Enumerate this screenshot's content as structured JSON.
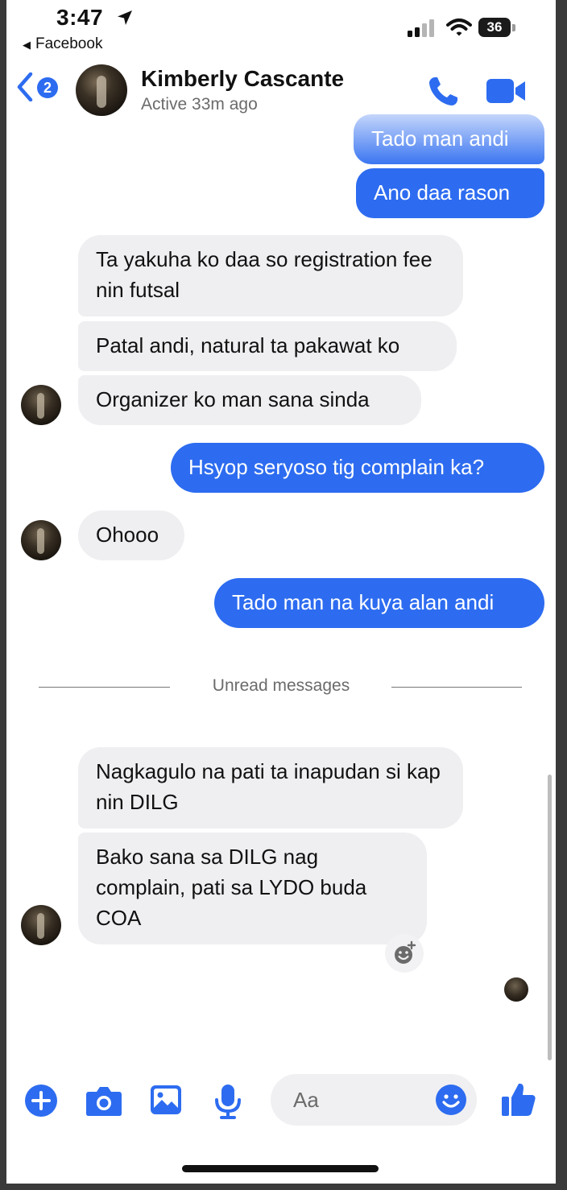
{
  "status_bar": {
    "time": "3:47",
    "back_app": "Facebook",
    "battery": "36"
  },
  "header": {
    "back_badge": "2",
    "contact_name": "Kimberly Cascante",
    "contact_status": "Active 33m ago"
  },
  "messages": [
    {
      "from": "me",
      "text": "Tado man andi"
    },
    {
      "from": "me",
      "text": "Ano daa rason"
    },
    {
      "from": "them",
      "text": "Ta yakuha ko daa so registration fee nin futsal"
    },
    {
      "from": "them",
      "text": "Patal andi, natural ta pakawat ko"
    },
    {
      "from": "them",
      "text": "Organizer ko man sana sinda"
    },
    {
      "from": "me",
      "text": "Hsyop seryoso tig complain ka?"
    },
    {
      "from": "them",
      "text": "Ohooo"
    },
    {
      "from": "me",
      "text": "Tado man na kuya alan andi"
    },
    {
      "from": "them",
      "text": "Nagkagulo na pati ta inapudan si kap nin DILG"
    },
    {
      "from": "them",
      "text": "Bako sana sa DILG nag complain, pati sa LYDO buda COA"
    }
  ],
  "unread_divider": "Unread messages",
  "composer": {
    "placeholder": "Aa"
  },
  "colors": {
    "accent": "#2d6cf0",
    "incoming_bubble": "#efeff2"
  },
  "icons": [
    "location-arrow-icon",
    "signal-icon",
    "wifi-icon",
    "battery-icon",
    "chevron-left-icon",
    "phone-icon",
    "video-icon",
    "add-reaction-icon",
    "plus-icon",
    "camera-icon",
    "image-icon",
    "microphone-icon",
    "emoji-icon",
    "thumbs-up-icon"
  ]
}
